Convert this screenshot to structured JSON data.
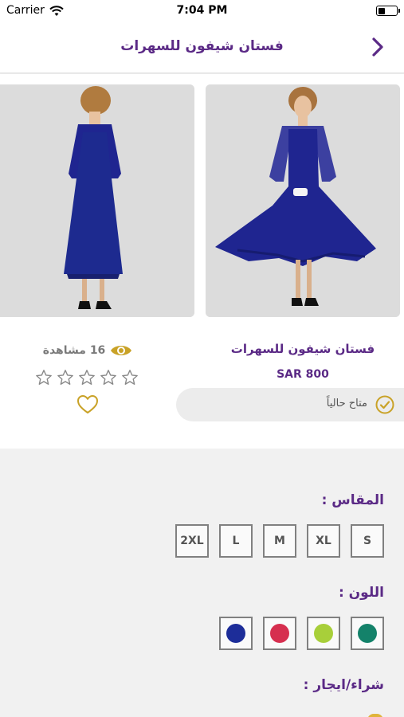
{
  "status_bar": {
    "carrier": "Carrier",
    "time": "7:04 PM",
    "wifi_icon": "wifi-icon",
    "battery_icon": "battery-icon"
  },
  "nav": {
    "title": "فستان شيفون للسهرات",
    "back_icon": "chevron-right-icon"
  },
  "product": {
    "name": "فستان شيفون للسهرات",
    "price": "SAR 800",
    "availability": "متاح حالياً",
    "views_text": "16 مشاهدة",
    "rating": 0,
    "rating_max": 5,
    "images": [
      "dress-front-photo",
      "dress-back-photo"
    ]
  },
  "options": {
    "size_label": "المقاس :",
    "sizes": [
      "S",
      "XL",
      "M",
      "L",
      "2XL"
    ],
    "color_label": "اللون :",
    "colors": [
      "#14826a",
      "#a8cf3a",
      "#d62f4f",
      "#1d2d99"
    ],
    "buy_label": "شراء/ايجار :"
  },
  "theme": {
    "primary": "#5b2a86",
    "accent": "#c9a227"
  }
}
